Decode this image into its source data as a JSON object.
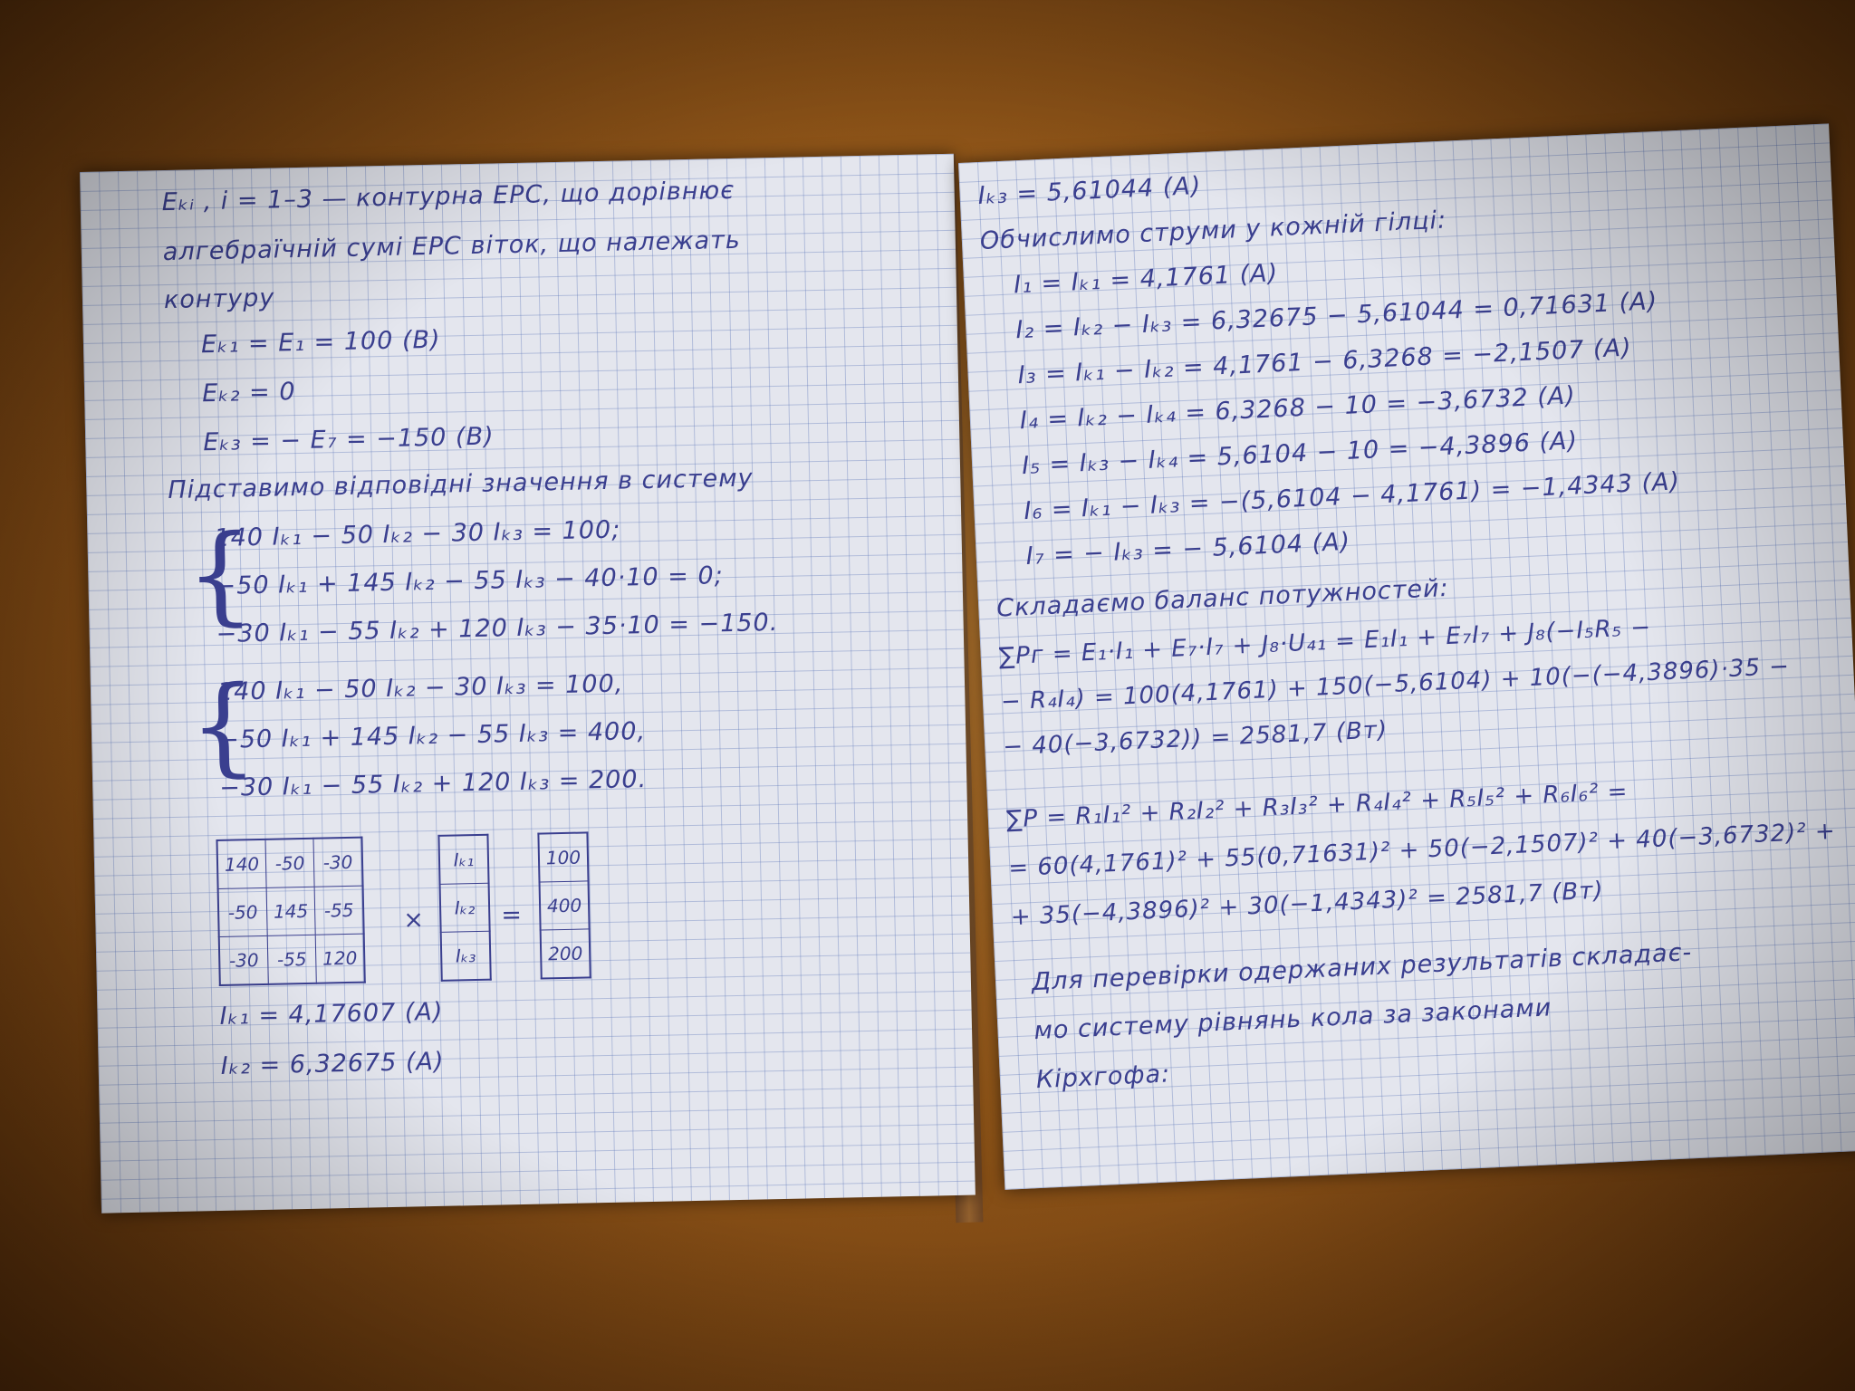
{
  "left_page": {
    "lines": [
      "Eₖᵢ , i = 1–3 — контурна ЕРС, що дорівнює",
      "алгебраїчній сумі ЕРС віток, що належать",
      "контуру",
      "Eₖ₁ = E₁ = 100 (B)",
      "Eₖ₂ = 0",
      "Eₖ₃ = − E₇ = −150 (B)",
      "Підставимо відповідні значення в систему"
    ],
    "system1": [
      "140 Iₖ₁ − 50 Iₖ₂ − 30 Iₖ₃ = 100;",
      "−50 Iₖ₁ + 145 Iₖ₂ − 55 Iₖ₃ − 40·10 = 0;",
      "−30 Iₖ₁ − 55 Iₖ₂ + 120 Iₖ₃ − 35·10 = −150."
    ],
    "system2": [
      "140 Iₖ₁ − 50 Iₖ₂ − 30 Iₖ₃ = 100,",
      "−50 Iₖ₁ + 145 Iₖ₂ − 55 Iₖ₃ = 400,",
      "−30 Iₖ₁ − 55 Iₖ₂ + 120 Iₖ₃ = 200."
    ],
    "matrix": [
      [
        "140",
        "-50",
        "-30"
      ],
      [
        "-50",
        "145",
        "-55"
      ],
      [
        "-30",
        "-55",
        "120"
      ]
    ],
    "vector_x": [
      "Iₖ₁",
      "Iₖ₂",
      "Iₖ₃"
    ],
    "vector_b": [
      "100",
      "400",
      "200"
    ],
    "times_sign": "×",
    "equals_sign": "=",
    "results": [
      "Iₖ₁ = 4,17607 (A)",
      "Iₖ₂ = 6,32675 (A)"
    ]
  },
  "right_page": {
    "lines": [
      "Iₖ₃ = 5,61044 (A)",
      "Обчислимо струми у кожній гілці:",
      "I₁ = Iₖ₁ = 4,1761 (A)",
      "I₂ = Iₖ₂ − Iₖ₃ = 6,32675 − 5,61044 = 0,71631 (A)",
      "I₃ = Iₖ₁ − Iₖ₂ = 4,1761 − 6,3268 = −2,1507 (A)",
      "I₄ = Iₖ₂ − Iₖ₄ = 6,3268 − 10 = −3,6732 (A)",
      "I₅ = Iₖ₃ − Iₖ₄ = 5,6104 − 10 = −4,3896 (A)",
      "I₆ = Iₖ₁ − Iₖ₃ = −(5,6104 − 4,1761) = −1,4343 (A)",
      "I₇ = − Iₖ₃ = − 5,6104 (A)",
      "Складаємо баланс потужностей:",
      "∑Pг = E₁·I₁ + E₇·I₇ + J₈·U₄₁ = E₁I₁ + E₇I₇ + J₈(−I₅R₅ −",
      "− R₄I₄) = 100(4,1761) + 150(−5,6104) + 10(−(−4,3896)·35 −",
      "− 40(−3,6732)) = 2581,7 (Вт)",
      "∑P = R₁I₁² + R₂I₂² + R₃I₃² + R₄I₄² + R₅I₅² + R₆I₆² =",
      "= 60(4,1761)² + 55(0,71631)² + 50(−2,1507)² + 40(−3,6732)² +",
      "+ 35(−4,3896)² + 30(−1,4343)² = 2581,7 (Вт)",
      "Для перевірки одержаних результатів складає-",
      "мо систему рівнянь кола за законами",
      "Кірхгофа:"
    ]
  }
}
